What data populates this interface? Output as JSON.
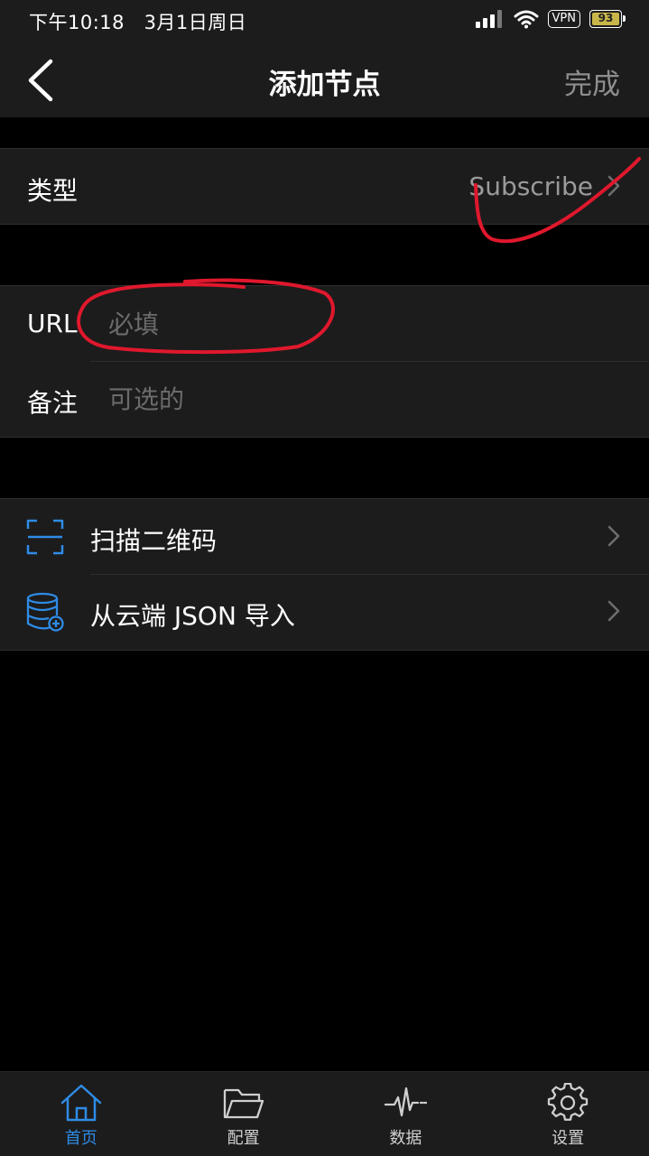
{
  "status_bar": {
    "time": "下午10:18",
    "date": "3月1日周日",
    "vpn": "VPN",
    "battery": "93",
    "icons": [
      "signal-icon",
      "wifi-icon"
    ]
  },
  "nav": {
    "back_icon": "chevron-left-icon",
    "title": "添加节点",
    "done": "完成"
  },
  "type_row": {
    "label": "类型",
    "value": "Subscribe"
  },
  "fields": {
    "url_label": "URL",
    "url_value": "",
    "url_placeholder": "必填",
    "remark_label": "备注",
    "remark_value": "",
    "remark_placeholder": "可选的"
  },
  "actions": {
    "scan": {
      "label": "扫描二维码",
      "icon": "qr-scan-icon"
    },
    "import": {
      "label": "从云端 JSON 导入",
      "icon": "database-add-icon"
    }
  },
  "tabs": [
    {
      "label": "首页",
      "icon": "home-icon",
      "active": true
    },
    {
      "label": "配置",
      "icon": "folder-icon",
      "active": false
    },
    {
      "label": "数据",
      "icon": "activity-icon",
      "active": false
    },
    {
      "label": "设置",
      "icon": "gear-icon",
      "active": false
    }
  ],
  "colors": {
    "accent": "#2f8be6",
    "background": "#000000",
    "surface": "#1c1c1c",
    "annotation": "#e0182d"
  }
}
